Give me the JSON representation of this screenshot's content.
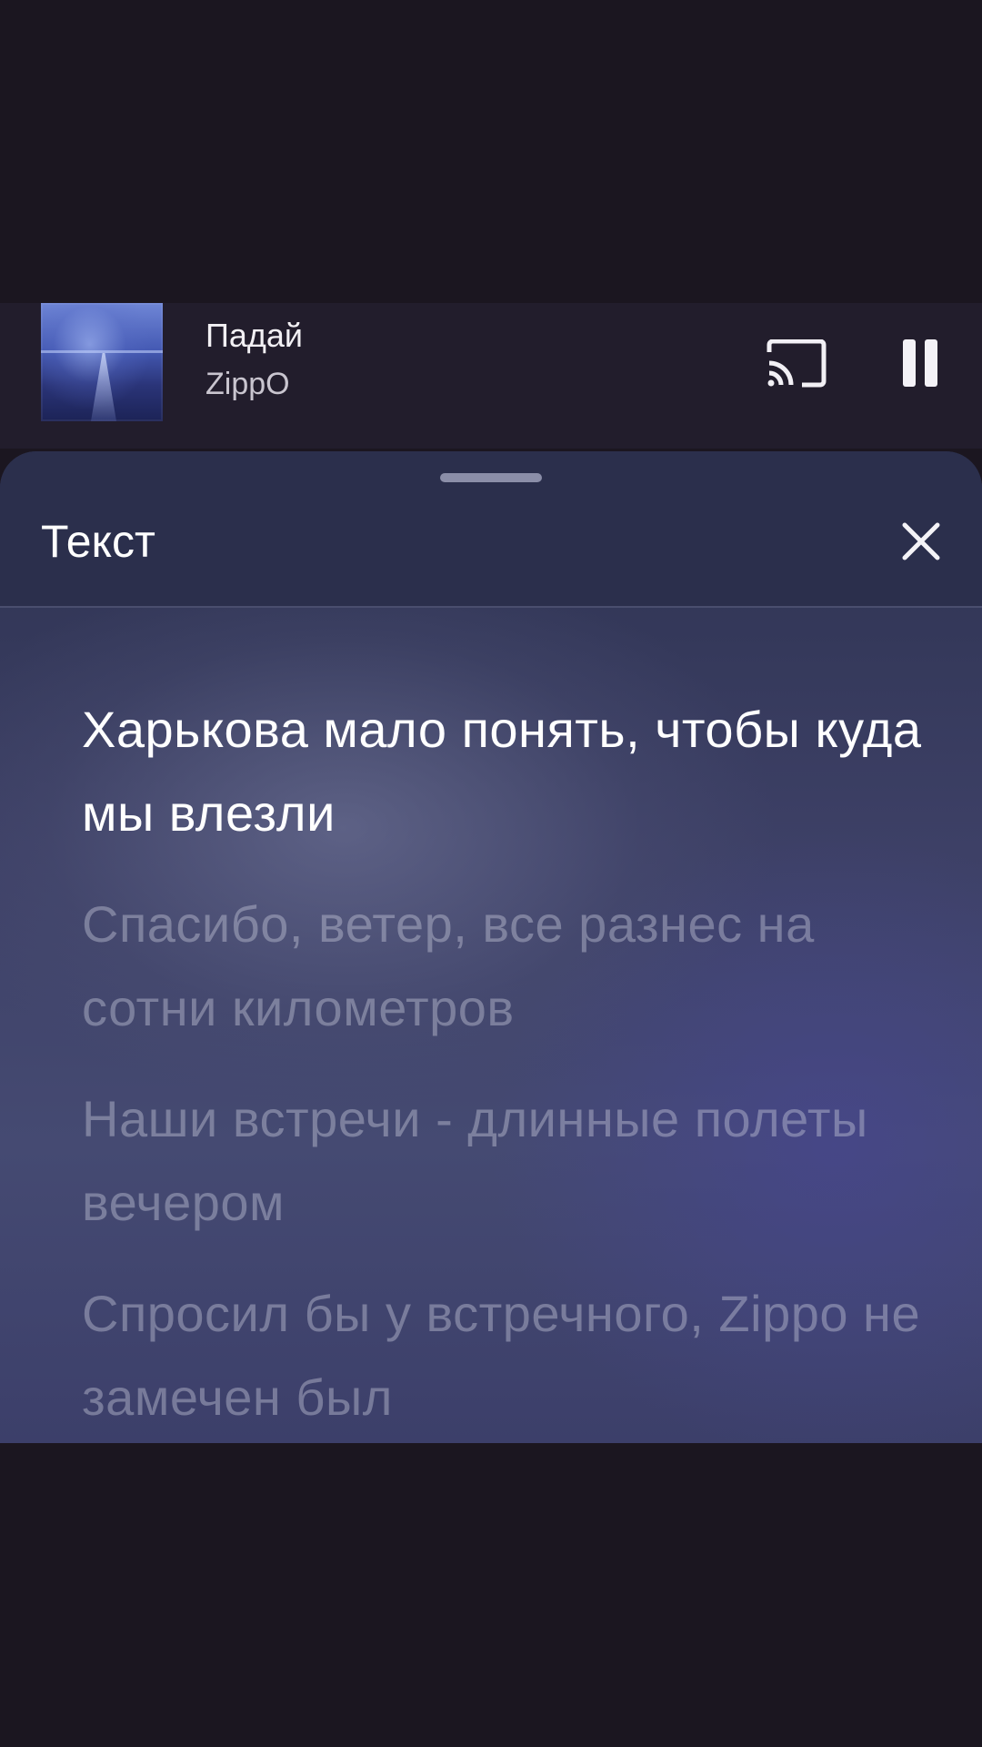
{
  "mini_player": {
    "title": "Падай",
    "artist": "ZippO",
    "cast_icon": "cast-icon",
    "pause_icon": "pause-icon"
  },
  "lyrics_sheet": {
    "title": "Текст",
    "close_icon": "close-icon",
    "lines": [
      {
        "text": "Харькова мало понять, чтобы куда мы влезли",
        "active": true
      },
      {
        "text": "Спасибо, ветер, все разнес на сотни километров",
        "active": false
      },
      {
        "text": "Наши встречи - длинные полеты вечером",
        "active": false
      },
      {
        "text": "Спросил бы у встречного, Zippo не замечен был",
        "active": false
      }
    ]
  },
  "colors": {
    "background": "#1b1620",
    "mini_player_bg": "#221d2c",
    "sheet_header_bg": "#2b2f4c",
    "active_lyric": "#ffffff",
    "inactive_lyric": "#9b9db3"
  }
}
